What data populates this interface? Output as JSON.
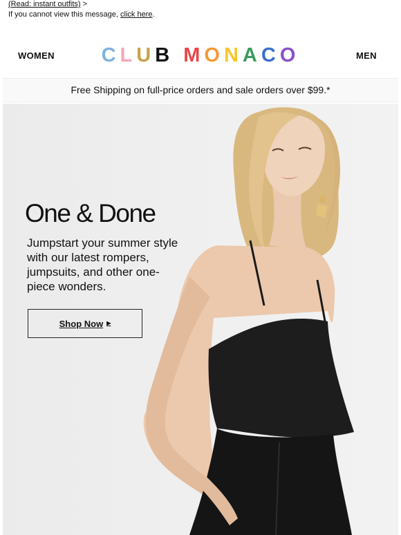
{
  "preheader": {
    "line1_link": "(Read: instant outfits)",
    "line1_suffix": " >",
    "line2_text": "If you cannot view this message, ",
    "line2_link": "click here",
    "line2_end": "."
  },
  "header": {
    "women_label": "WOMEN",
    "men_label": "MEN",
    "logo_text": "CLUB MONACO",
    "logo_letter_colors": [
      "#7fb3e0",
      "#f4a7b9",
      "#c8a24a",
      "#111111",
      "#e8464a",
      "#f29a3a",
      "#f6c72a",
      "#3a9c5e",
      "#3b6fd0",
      "#8a4fc8"
    ]
  },
  "shipping": {
    "text": "Free Shipping on full-price orders and sale orders over $99.*"
  },
  "hero": {
    "headline": "One & Done",
    "body": "Jumpstart your summer style with our latest rompers, jumpsuits, and other one-piece wonders.",
    "cta_label": "Shop Now",
    "cta_icon": "caret-right-icon",
    "image_description_icon": "model-photo"
  },
  "colors": {
    "hero_bg": "#eeeeee",
    "ship_bg": "#faf9f9",
    "text": "#111111"
  }
}
